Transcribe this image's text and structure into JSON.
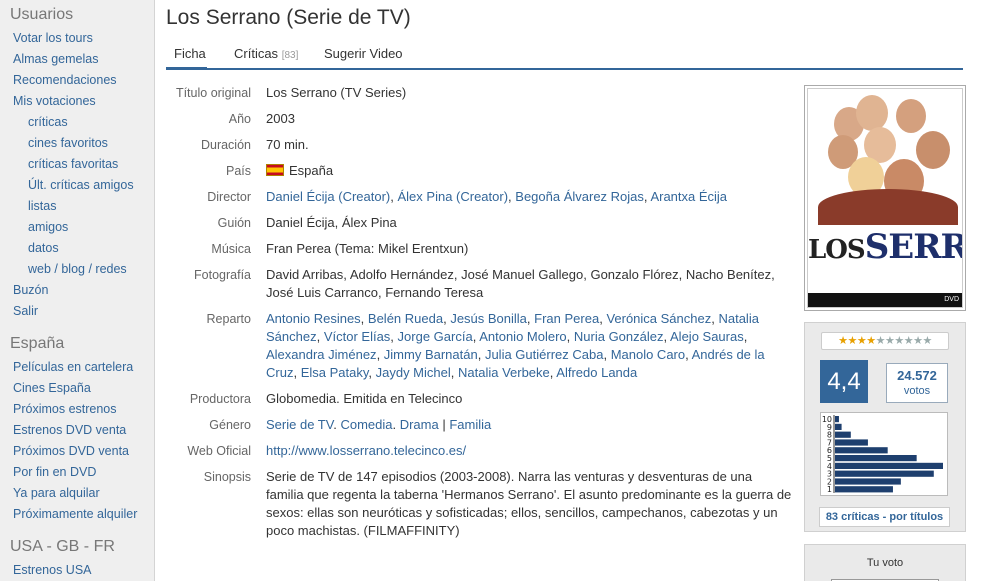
{
  "sidebar": {
    "sections": [
      {
        "heading": "Usuarios",
        "items": [
          {
            "label": "Votar los tours",
            "sub": false
          },
          {
            "label": "Almas gemelas",
            "sub": false
          },
          {
            "label": "Recomendaciones",
            "sub": false
          },
          {
            "label": "Mis votaciones",
            "sub": false
          },
          {
            "label": "críticas",
            "sub": true
          },
          {
            "label": "cines favoritos",
            "sub": true
          },
          {
            "label": "críticas favoritas",
            "sub": true
          },
          {
            "label": "Últ. críticas amigos",
            "sub": true
          },
          {
            "label": "listas",
            "sub": true
          },
          {
            "label": "amigos",
            "sub": true
          },
          {
            "label": "datos",
            "sub": true
          },
          {
            "label": "web / blog / redes",
            "sub": true
          },
          {
            "label": "Buzón",
            "sub": false
          },
          {
            "label": "Salir",
            "sub": false
          }
        ]
      },
      {
        "heading": "España",
        "items": [
          {
            "label": "Películas en cartelera",
            "sub": false
          },
          {
            "label": "Cines España",
            "sub": false
          },
          {
            "label": "Próximos estrenos",
            "sub": false
          },
          {
            "label": "Estrenos DVD venta",
            "sub": false
          },
          {
            "label": "Próximos DVD venta",
            "sub": false
          },
          {
            "label": "Por fin en DVD",
            "sub": false
          },
          {
            "label": "Ya para alquilar",
            "sub": false
          },
          {
            "label": "Próximamente alquiler",
            "sub": false
          }
        ]
      },
      {
        "heading": "USA - GB - FR",
        "items": [
          {
            "label": "Estrenos USA",
            "sub": false
          }
        ]
      }
    ]
  },
  "title": "Los Serrano (Serie de TV)",
  "tabs": [
    {
      "label": "Ficha",
      "count": "",
      "active": true
    },
    {
      "label": "Críticas",
      "count": "[83]",
      "active": false
    },
    {
      "label": "Sugerir Video",
      "count": "",
      "active": false
    }
  ],
  "info": [
    {
      "label": "Título original",
      "parts": [
        {
          "t": "Los Serrano (TV Series)"
        }
      ]
    },
    {
      "label": "Año",
      "parts": [
        {
          "t": "2003"
        }
      ]
    },
    {
      "label": "Duración",
      "parts": [
        {
          "t": "70 min."
        }
      ]
    },
    {
      "label": "País",
      "flag": true,
      "parts": [
        {
          "t": "España"
        }
      ]
    },
    {
      "label": "Director",
      "parts": [
        {
          "t": "Daniel Écija (Creator)",
          "link": true
        },
        {
          "t": ", "
        },
        {
          "t": "Álex Pina (Creator)",
          "link": true
        },
        {
          "t": ", "
        },
        {
          "t": "Begoña Álvarez Rojas",
          "link": true
        },
        {
          "t": ", "
        },
        {
          "t": "Arantxa Écija",
          "link": true
        }
      ]
    },
    {
      "label": "Guión",
      "parts": [
        {
          "t": "Daniel Écija, Álex Pina"
        }
      ]
    },
    {
      "label": "Música",
      "parts": [
        {
          "t": "Fran Perea (Tema: Mikel Erentxun)"
        }
      ]
    },
    {
      "label": "Fotografía",
      "parts": [
        {
          "t": "David Arribas, Adolfo Hernández, José Manuel Gallego, Gonzalo Flórez, Nacho Benítez, José Luis Carranco, Fernando Teresa"
        }
      ]
    },
    {
      "label": "Reparto",
      "parts": [
        {
          "t": "Antonio Resines",
          "link": true
        },
        {
          "t": ", "
        },
        {
          "t": "Belén Rueda",
          "link": true
        },
        {
          "t": ", "
        },
        {
          "t": "Jesús Bonilla",
          "link": true
        },
        {
          "t": ", "
        },
        {
          "t": "Fran Perea",
          "link": true
        },
        {
          "t": ", "
        },
        {
          "t": "Verónica Sánchez",
          "link": true
        },
        {
          "t": ", "
        },
        {
          "t": "Natalia Sánchez",
          "link": true
        },
        {
          "t": ", "
        },
        {
          "t": "Víctor Elías",
          "link": true
        },
        {
          "t": ", "
        },
        {
          "t": "Jorge García",
          "link": true
        },
        {
          "t": ", "
        },
        {
          "t": "Antonio Molero",
          "link": true
        },
        {
          "t": ", "
        },
        {
          "t": "Nuria González",
          "link": true
        },
        {
          "t": ", "
        },
        {
          "t": "Alejo Sauras",
          "link": true
        },
        {
          "t": ", "
        },
        {
          "t": "Alexandra Jiménez",
          "link": true
        },
        {
          "t": ", "
        },
        {
          "t": "Jimmy Barnatán",
          "link": true
        },
        {
          "t": ", "
        },
        {
          "t": "Julia Gutiérrez Caba",
          "link": true
        },
        {
          "t": ", "
        },
        {
          "t": "Manolo Caro",
          "link": true
        },
        {
          "t": ", "
        },
        {
          "t": "Andrés de la Cruz",
          "link": true
        },
        {
          "t": ", "
        },
        {
          "t": "Elsa Pataky",
          "link": true
        },
        {
          "t": ", "
        },
        {
          "t": "Jaydy Michel",
          "link": true
        },
        {
          "t": ", "
        },
        {
          "t": "Natalia Verbeke",
          "link": true
        },
        {
          "t": ", "
        },
        {
          "t": "Alfredo Landa",
          "link": true
        }
      ]
    },
    {
      "label": "Productora",
      "parts": [
        {
          "t": "Globomedia. Emitida en Telecinco"
        }
      ]
    },
    {
      "label": "Género",
      "parts": [
        {
          "t": "Serie de TV",
          "link": true
        },
        {
          "t": ". "
        },
        {
          "t": "Comedia",
          "link": true
        },
        {
          "t": ". "
        },
        {
          "t": "Drama",
          "link": true
        },
        {
          "t": " | "
        },
        {
          "t": "Familia",
          "link": true
        }
      ]
    },
    {
      "label": "Web Oficial",
      "parts": [
        {
          "t": "http://www.losserrano.telecinco.es/",
          "link": true
        }
      ]
    },
    {
      "label": "Sinopsis",
      "parts": [
        {
          "t": "Serie de TV de 147 episodios (2003-2008). Narra las venturas y desventuras de una familia que regenta la taberna 'Hermanos Serrano'. El asunto predominante es la guerra de sexos: ellas son neuróticas y sofisticadas; ellos, sencillos, campechanos, cabezotas y un poco machistas. (FILMAFFINITY)"
        }
      ]
    }
  ],
  "poster": {
    "logo_small": "LOS",
    "logo_big": "SERRANO",
    "strip": "DVD"
  },
  "rating": {
    "stars_filled": 4,
    "stars_total": 10,
    "average": "4,4",
    "votes_count": "24.572",
    "votes_label": "votos",
    "critics_link": "83 críticas - por títulos",
    "histogram_labels": [
      "10",
      "9",
      "8",
      "7",
      "6",
      "5",
      "4",
      "3",
      "2",
      "1"
    ],
    "histogram_values": [
      3,
      5,
      12,
      25,
      40,
      62,
      82,
      75,
      50,
      44
    ],
    "color_bar": "#1e3f6e"
  },
  "your_vote": {
    "label": "Tu voto"
  }
}
